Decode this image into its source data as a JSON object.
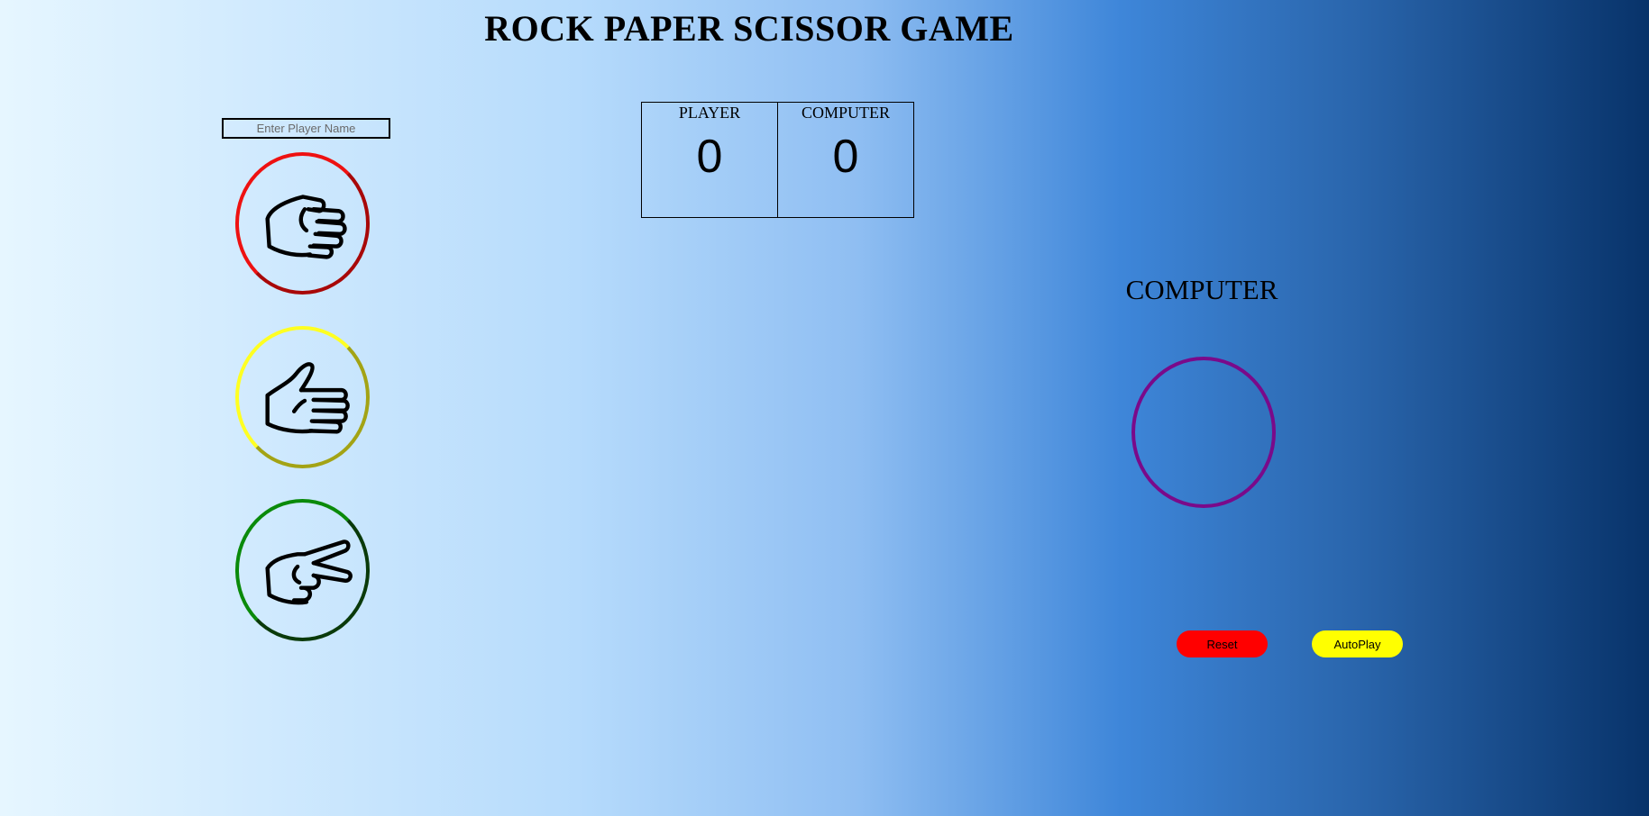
{
  "header": {
    "title": "ROCK PAPER SCISSOR GAME"
  },
  "player": {
    "name_placeholder": "Enter Player Name",
    "name_value": ""
  },
  "choices": [
    {
      "name": "rock",
      "icon": "rock-fist-icon",
      "ring_color": "#ee1111"
    },
    {
      "name": "paper",
      "icon": "paper-hand-icon",
      "ring_color": "#ffff22"
    },
    {
      "name": "scissor",
      "icon": "scissor-hand-icon",
      "ring_color": "#0a8a0a"
    }
  ],
  "scoreboard": {
    "player_label": "PLAYER",
    "player_score": "0",
    "computer_label": "COMPUTER",
    "computer_score": "0"
  },
  "computer": {
    "heading": "COMPUTER",
    "ring_color": "#7a0a8a"
  },
  "controls": {
    "reset_label": "Reset",
    "reset_color": "#ff0000",
    "autoplay_label": "AutoPlay",
    "autoplay_color": "#ffff00"
  }
}
